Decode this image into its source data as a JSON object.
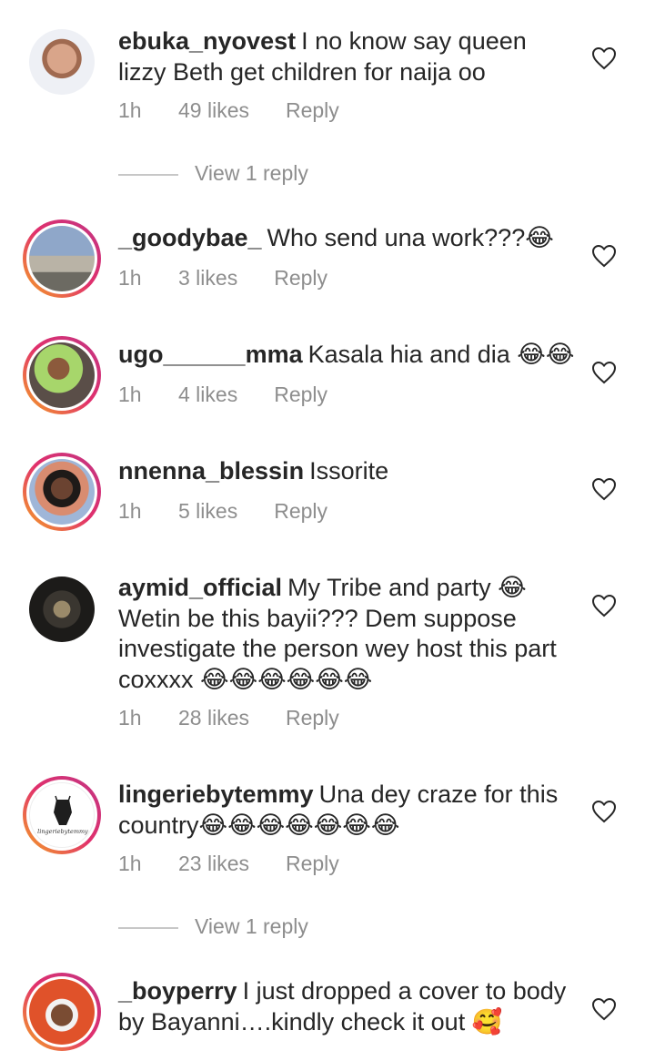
{
  "comments": [
    {
      "username": "ebuka_nyovest",
      "text": "I no know say queen lizzy Beth get children for naija oo",
      "time": "1h",
      "likes": "49 likes",
      "reply": "Reply",
      "view_replies": "View 1 reply",
      "avatar": "bald-man-avatar"
    },
    {
      "username": "_goodybae_",
      "text": "Who send una work???😂",
      "time": "1h",
      "likes": "3 likes",
      "reply": "Reply",
      "avatar": "landscape-avatar"
    },
    {
      "username": "ugo______mma",
      "text": "Kasala hia and dia 😂😂",
      "time": "1h",
      "likes": "4 likes",
      "reply": "Reply",
      "avatar": "woman-green-avatar"
    },
    {
      "username": "nnenna_blessin",
      "text": "Issorite",
      "time": "1h",
      "likes": "5 likes",
      "reply": "Reply",
      "avatar": "woman-smile-avatar"
    },
    {
      "username": "aymid_official",
      "text": "My Tribe and party 😂 Wetin be this bayii??? Dem suppose investigate the person wey host this part coxxxx 😂😂😂😂😂😂",
      "time": "1h",
      "likes": "28 likes",
      "reply": "Reply",
      "avatar": "man-dark-avatar"
    },
    {
      "username": "lingeriebytemmy",
      "text": "Una dey craze for this country😂😂😂😂😂😂😂",
      "time": "1h",
      "likes": "23 likes",
      "reply": "Reply",
      "view_replies": "View 1 reply",
      "avatar": "brand-logo-avatar",
      "logo_text": "lingeriebytemmy"
    },
    {
      "username": "_boyperry",
      "text": "I just dropped a cover to body by Bayanni….kindly check it out 🥰",
      "avatar": "man-cap-avatar"
    }
  ]
}
